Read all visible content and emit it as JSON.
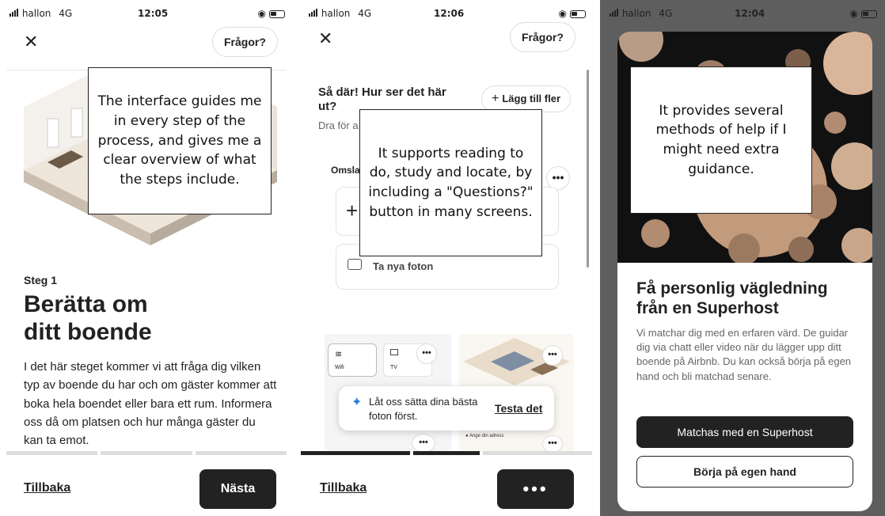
{
  "panel1": {
    "status": {
      "carrier": "hallon",
      "network": "4G",
      "time": "12:05"
    },
    "questions_label": "Frågor?",
    "step_label": "Steg 1",
    "title_line1": "Berätta om",
    "title_line2": "ditt boende",
    "body": "I det här steget kommer vi att fråga dig vilken typ av boende du har och om gäster kommer att boka hela boendet eller bara ett rum. Informera oss då om platsen och hur många gäster du kan ta emot.",
    "back_label": "Tillbaka",
    "next_label": "Nästa",
    "callout": "The interface guides me in every step of the process, and gives me a clear overview of what the steps include."
  },
  "panel2": {
    "status": {
      "carrier": "hallon",
      "network": "4G",
      "time": "12:06"
    },
    "questions_label": "Frågor?",
    "heading": "Så där! Hur ser det här ut?",
    "subtext": "Dra för a",
    "add_more_label": "Lägg till fler",
    "cover_label": "Omsla",
    "new_photos_label": "Ta nya foton",
    "wifi_label": "Wifi",
    "tv_label": "TV",
    "toast_text": "Låt oss sätta dina bästa foton först.",
    "toast_action": "Testa det",
    "address_label": "Ange din adress",
    "back_label": "Tillbaka",
    "callout": "It supports reading to do, study and locate, by including a \"Questions?\" button in many screens."
  },
  "panel3": {
    "status": {
      "carrier": "hallon",
      "network": "4G",
      "time": "12:04"
    },
    "title": "Få personlig vägledning från en Superhost",
    "body": "Vi matchar dig med en erfaren värd. De guidar dig via chatt eller video när du lägger upp ditt boende på Airbnb. Du kan också börja på egen hand och bli matchad senare.",
    "primary_label": "Matchas med en Superhost",
    "secondary_label": "Börja på egen hand",
    "callout": "It provides several methods of help if I might need extra guidance."
  },
  "colors": {
    "dark": "#222222",
    "accent_blue": "#2a7de1",
    "panel3_backdrop": "#5e5e5e"
  }
}
